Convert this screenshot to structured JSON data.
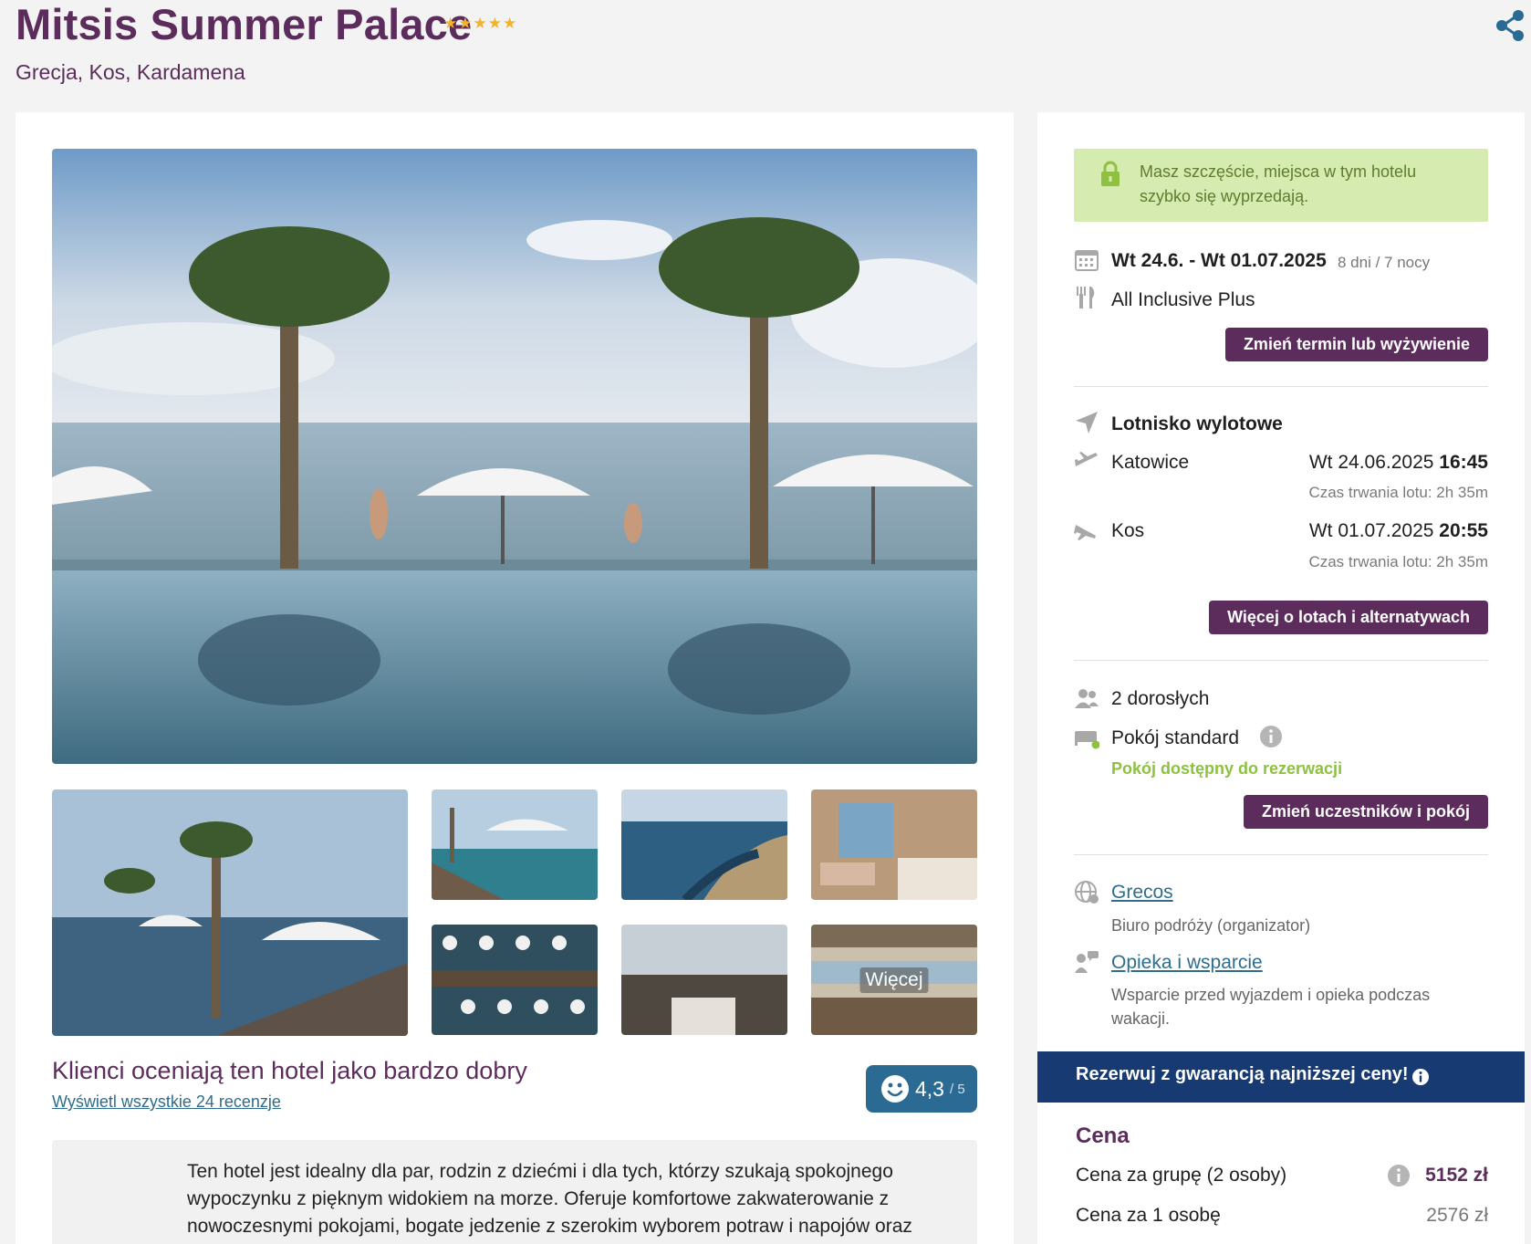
{
  "header": {
    "title": "Mitsis Summer Palace",
    "stars": 5,
    "location": "Grecja, Kos, Kardamena"
  },
  "gallery": {
    "more_label": "Więcej"
  },
  "rating": {
    "heading": "Klienci oceniają ten hotel jako bardzo dobry",
    "reviews_link": "Wyświetl wszystkie 24 recenzje",
    "score": "4,3",
    "score_max": "/ 5"
  },
  "summary": {
    "text": "Ten hotel jest idealny dla par, rodzin z dziećmi i dla tych, którzy szukają spokojnego wypoczynku z pięknym widokiem na morze. Oferuje komfortowe zakwaterowanie z nowoczesnymi pokojami, bogate jedzenie z szerokim wyborem potraw i napojów oraz"
  },
  "booking": {
    "alert": "Masz szczęście, miejsca w tym hotelu szybko się wyprzedają.",
    "dates": "Wt 24.6. - Wt 01.07.2025",
    "duration": "8 dni / 7 nocy",
    "board": "All Inclusive Plus",
    "change_date_button": "Zmień termin lub wyżywienie",
    "airport_label": "Lotnisko wylotowe",
    "outbound": {
      "city": "Katowice",
      "date": "Wt 24.06.2025",
      "time": "16:45",
      "duration": "Czas trwania lotu: 2h 35m"
    },
    "inbound": {
      "city": "Kos",
      "date": "Wt 01.07.2025",
      "time": "20:55",
      "duration": "Czas trwania lotu: 2h 35m"
    },
    "flights_button": "Więcej o lotach i alternatywach",
    "guests": "2 dorosłych",
    "room": "Pokój standard",
    "room_status": "Pokój dostępny do rezerwacji",
    "change_room_button": "Zmień uczestników i pokój",
    "organizer_link": "Grecos",
    "organizer_desc": "Biuro podróży (organizator)",
    "support_link": "Opieka i wsparcie",
    "support_desc": "Wsparcie przed wyjazdem i opieka podczas wakacji."
  },
  "promo": {
    "text": "Rezerwuj z gwarancją najniższej ceny!"
  },
  "price": {
    "heading": "Cena",
    "group_label": "Cena za grupę (2 osoby)",
    "group_value": "5152 zł",
    "person_label": "Cena za 1 osobę",
    "person_value": "2576 zł"
  },
  "colors": {
    "brand_purple": "#5c2d5c",
    "promo_blue": "#173a73",
    "alert_green_bg": "#d6ebb0",
    "status_green": "#8dc13f",
    "score_blue": "#2a6a93"
  },
  "icons": [
    "star-icon",
    "share-icon",
    "lock-icon",
    "calendar-icon",
    "cutlery-icon",
    "navigation-arrow-icon",
    "plane-takeoff-icon",
    "plane-landing-icon",
    "people-icon",
    "bed-icon",
    "info-icon",
    "globe-icon",
    "support-icon",
    "smile-icon"
  ]
}
